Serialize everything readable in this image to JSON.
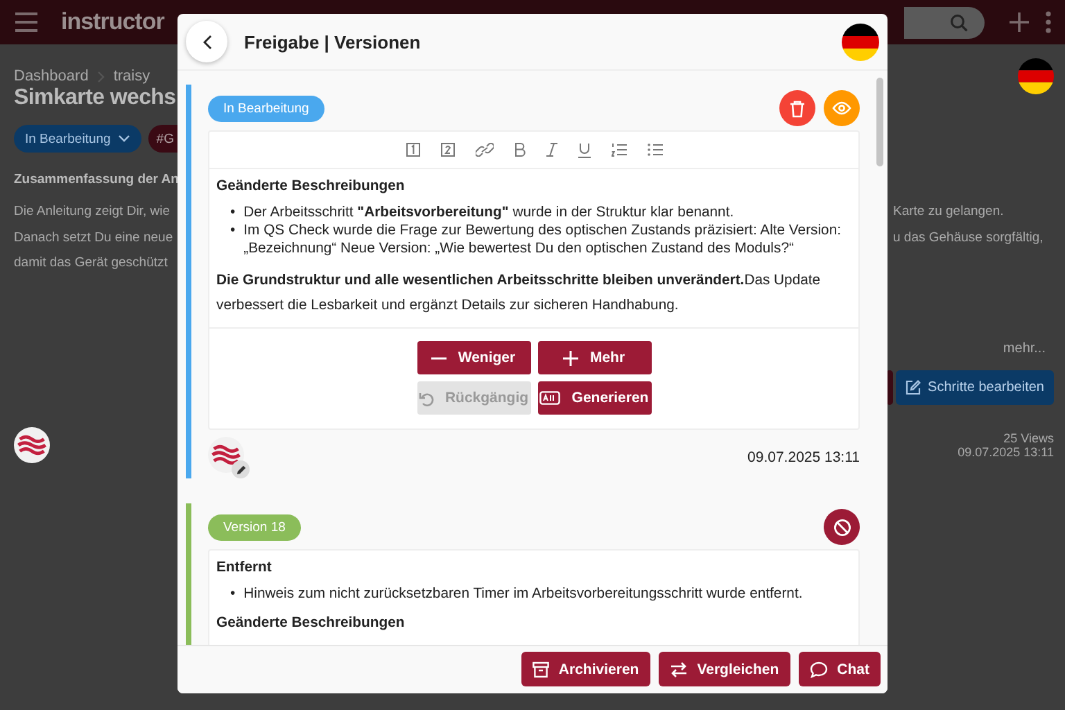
{
  "background": {
    "logo": "instructor",
    "breadcrumbs": [
      "Dashboard",
      "traisy"
    ],
    "page_title": "Simkarte wechs",
    "status_dropdown": "In Bearbeitung",
    "tag": "#G",
    "summary_heading": "Zusammenfassung der An",
    "summary_lines": [
      {
        "left": "Die Anleitung zeigt Dir, wie",
        "right": "Karte zu gelangen."
      },
      {
        "left": "Danach setzt Du eine neue",
        "right": "u das Gehäuse sorgfältig,"
      },
      {
        "left": "damit das Gerät geschützt"
      }
    ],
    "more_link": "mehr...",
    "edit_steps_button": "Schritte bearbeiten",
    "views": "25 Views",
    "date": "09.07.2025 13:11"
  },
  "dialog": {
    "title": "Freigabe | Versionen",
    "versions": [
      {
        "kind": "draft",
        "badge": "In Bearbeitung",
        "color": "#4aa8ee",
        "actions": [
          {
            "kind": "delete",
            "color": "#f44336"
          },
          {
            "kind": "view",
            "color": "#ff9800"
          }
        ],
        "content": [
          {
            "kind": "heading",
            "text": "Geänderte Beschreibungen"
          },
          {
            "kind": "bullets",
            "marker": "•",
            "items": [
              "Der Arbeitsschritt **\"Arbeitsvorbereitung\"** wurde in der Struktur klar benannt.",
              "Im QS Check wurde die Frage zur Bewertung des optischen Zustands präzisiert:  Alte Version: „Bezeichnung“  Neue Version: „Wie bewertest Du den optischen Zustand des Moduls?“"
            ]
          },
          {
            "kind": "paragraph",
            "text": "**Die Grundstruktur und alle wesentlichen Arbeitsschritte bleiben unverändert.**Das Update verbessert die Lesbarkeit und ergänzt Details zur sicheren Handhabung."
          }
        ],
        "buttons": [
          {
            "kind": "less",
            "label": "Weniger",
            "disabled": false
          },
          {
            "kind": "more",
            "label": "Mehr",
            "disabled": false
          },
          {
            "kind": "undo",
            "label": "Rückgängig",
            "disabled": true
          },
          {
            "kind": "generate",
            "label": "Generieren",
            "disabled": false
          }
        ],
        "date": "09.07.2025 13:11"
      },
      {
        "kind": "archived",
        "badge": "Version 18",
        "color": "#8bbd5a",
        "actions": [
          {
            "kind": "block",
            "color": "#9c1b36"
          }
        ],
        "content": [
          {
            "kind": "heading",
            "text": "Entfernt"
          },
          {
            "kind": "bullets",
            "marker": "•",
            "items": [
              "Hinweis zum nicht zurücksetzbaren Timer im Arbeitsvorbereitungsschritt wurde entfernt."
            ]
          },
          {
            "kind": "heading",
            "text": "Geänderte Beschreibungen"
          }
        ]
      }
    ],
    "footer_buttons": [
      {
        "kind": "archive",
        "label": "Archivieren"
      },
      {
        "kind": "compare",
        "label": "Vergleichen"
      },
      {
        "kind": "chat",
        "label": "Chat"
      }
    ]
  }
}
